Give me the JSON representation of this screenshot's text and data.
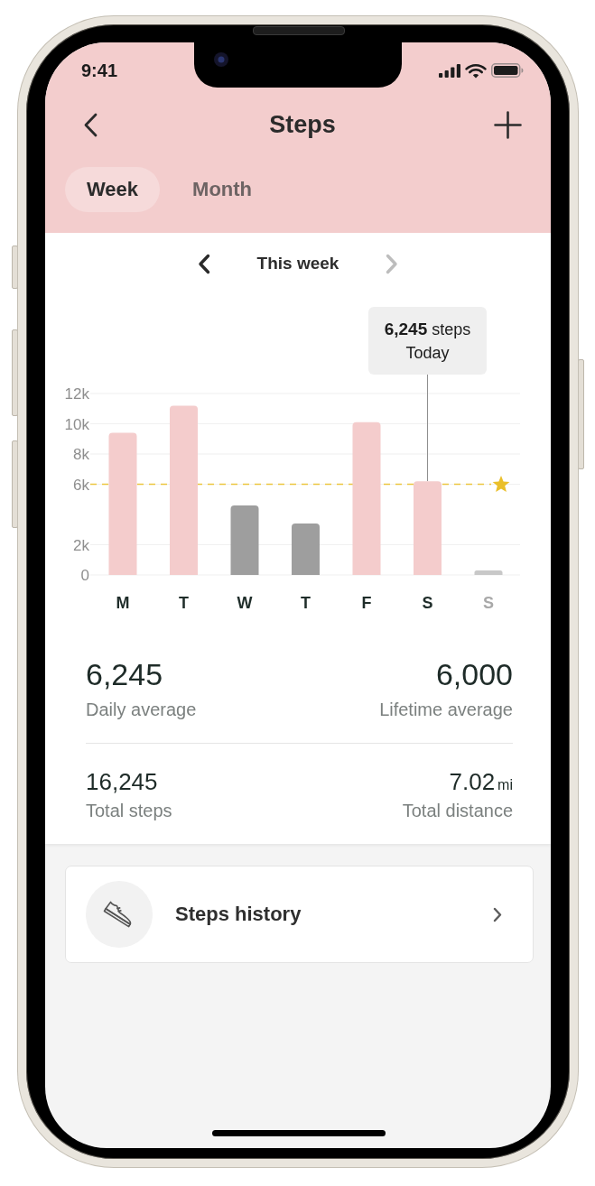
{
  "status_bar": {
    "time": "9:41"
  },
  "header": {
    "title": "Steps"
  },
  "tabs": [
    {
      "label": "Week",
      "selected": true
    },
    {
      "label": "Month",
      "selected": false
    }
  ],
  "period": {
    "label": "This week",
    "previous": {
      "disabled": false
    },
    "next": {
      "disabled": true
    }
  },
  "chart": {
    "chart_data": {
      "type": "bar",
      "categories": [
        "M",
        "T",
        "W",
        "T",
        "F",
        "S",
        "S"
      ],
      "series": [
        {
          "color": "#f4cccc",
          "values": [
            9400,
            11200,
            null,
            null,
            10100,
            6200,
            null
          ]
        },
        {
          "color": "#9e9e9e",
          "values": [
            null,
            null,
            4600,
            3400,
            null,
            null,
            null
          ]
        },
        {
          "color": "#c8c8c8",
          "values": [
            null,
            null,
            null,
            null,
            null,
            null,
            300
          ]
        }
      ],
      "ylim": [
        0,
        12000
      ],
      "yticks": [
        {
          "value": 0,
          "label": "0"
        },
        {
          "value": 2000,
          "label": "2k"
        },
        {
          "value": 6000,
          "label": "6k"
        },
        {
          "value": 8000,
          "label": "8k"
        },
        {
          "value": 10000,
          "label": "10k"
        },
        {
          "value": 12000,
          "label": "12k"
        }
      ],
      "grid": true,
      "ref_lines": [
        {
          "axis": "y",
          "value": 6000,
          "color": "#ecc640"
        }
      ]
    },
    "days": [
      {
        "upcoming": false
      },
      {
        "upcoming": false
      },
      {
        "upcoming": false
      },
      {
        "upcoming": false
      },
      {
        "upcoming": false
      },
      {
        "upcoming": false,
        "tooltip": {
          "text": "**6,245** steps",
          "label": "Today"
        }
      },
      {
        "upcoming": true
      }
    ]
  },
  "stats": [
    {
      "items": [
        {
          "value": "6,245",
          "label": "Daily average"
        },
        {
          "value": "6,000",
          "label": "Lifetime average"
        }
      ]
    },
    {
      "items": [
        {
          "value": "16,245",
          "label": "Total steps"
        },
        {
          "value": "7.02",
          "unit": "mi",
          "label": "Total distance"
        }
      ]
    }
  ],
  "history_link": {
    "label": "Steps history"
  }
}
